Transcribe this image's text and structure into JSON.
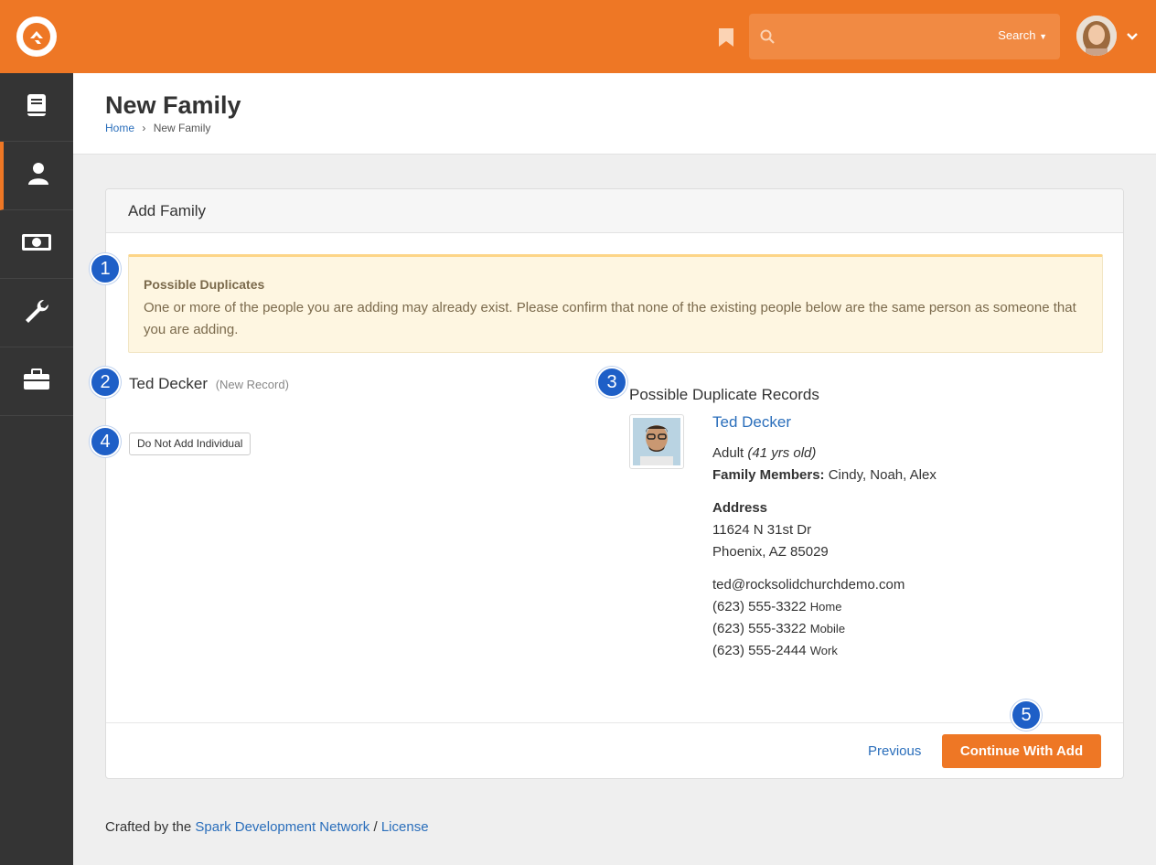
{
  "header": {
    "search_placeholder": "",
    "search_button_label": "Search",
    "colors": {
      "brand": "#ee7725",
      "search_bg": "#f18a43"
    }
  },
  "sidebar": {
    "items": [
      {
        "icon": "book-icon"
      },
      {
        "icon": "person-icon",
        "active": true
      },
      {
        "icon": "money-icon"
      },
      {
        "icon": "wrench-icon"
      },
      {
        "icon": "briefcase-icon"
      }
    ]
  },
  "page": {
    "title": "New Family",
    "breadcrumb": {
      "home": "Home",
      "current": "New Family"
    }
  },
  "panel": {
    "title": "Add Family",
    "alert": {
      "title": "Possible Duplicates",
      "text": "One or more of the people you are adding may already exist. Please confirm that none of the existing people below are the same person as someone that you are adding."
    },
    "new_record": {
      "name": "Ted Decker",
      "tag": "(New Record)"
    },
    "do_not_add_label": "Do Not Add Individual",
    "duplicates": {
      "heading": "Possible Duplicate Records",
      "name": "Ted Decker",
      "age_label": "Adult",
      "age_detail": "(41 yrs old)",
      "family_label": "Family Members:",
      "family_members": "Cindy, Noah, Alex",
      "address_label": "Address",
      "address_line1": "11624 N 31st Dr",
      "address_line2": "Phoenix, AZ 85029",
      "email": "ted@rocksolidchurchdemo.com",
      "phones": [
        {
          "number": "(623) 555-3322",
          "type": "Home"
        },
        {
          "number": "(623) 555-3322",
          "type": "Mobile"
        },
        {
          "number": "(623) 555-2444",
          "type": "Work"
        }
      ]
    },
    "previous_label": "Previous",
    "continue_label": "Continue With Add"
  },
  "badges": [
    "1",
    "2",
    "3",
    "4",
    "5"
  ],
  "footer": {
    "prefix": "Crafted by the",
    "network": "Spark Development Network",
    "sep": "/",
    "license": "License"
  }
}
